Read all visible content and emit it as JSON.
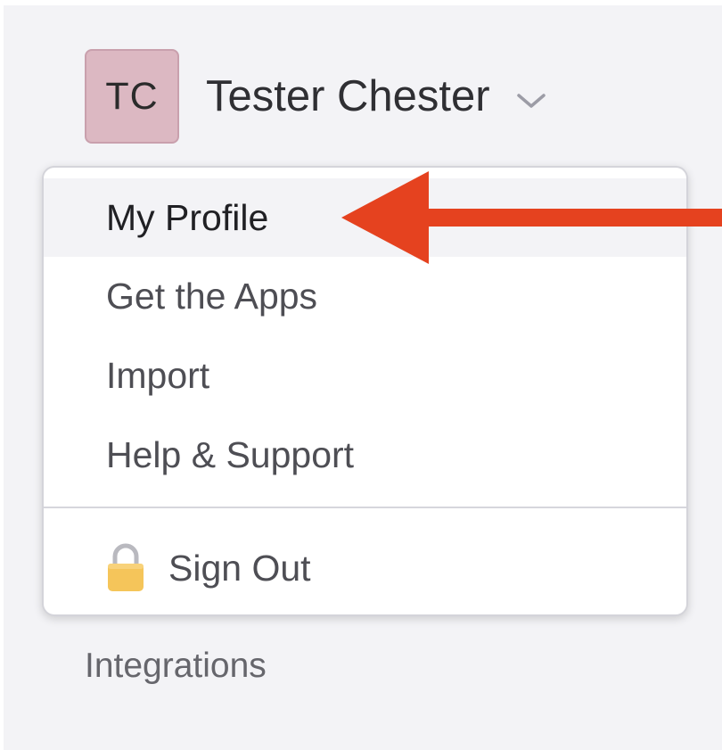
{
  "user": {
    "initials": "TC",
    "name": "Tester Chester"
  },
  "menu": {
    "items": [
      {
        "label": "My Profile"
      },
      {
        "label": "Get the Apps"
      },
      {
        "label": "Import"
      },
      {
        "label": "Help & Support"
      }
    ],
    "sign_out": {
      "label": "Sign Out",
      "icon": "lock-icon"
    }
  },
  "sidebar": {
    "integrations_label": "Integrations"
  },
  "colors": {
    "avatar_bg": "#dcb8c2",
    "annotation_arrow": "#e5421f",
    "lock_body": "#f5c55a",
    "active_row_bg": "#f3f3f6"
  }
}
